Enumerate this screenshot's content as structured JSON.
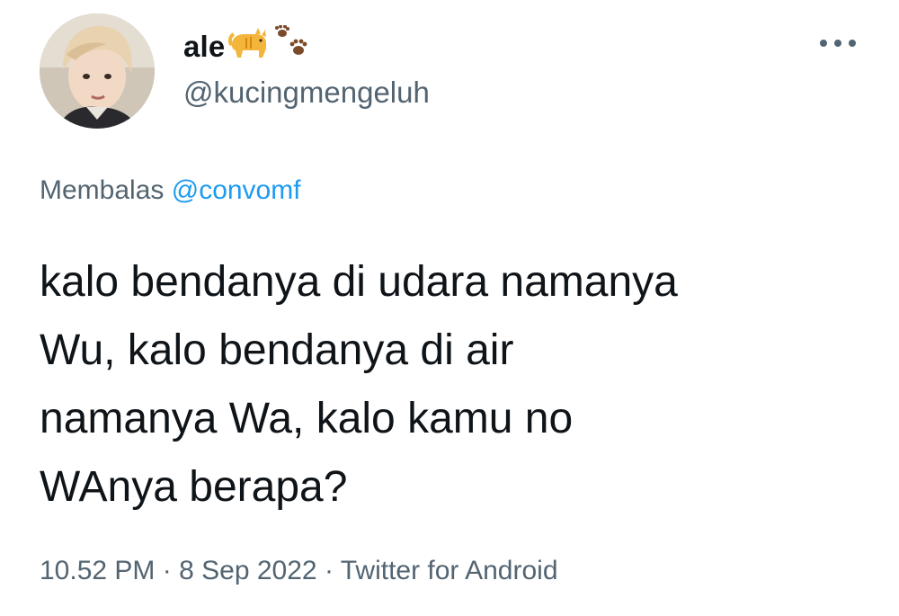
{
  "author": {
    "display_name": "ale",
    "handle": "@kucingmengeluh",
    "avatar": "avatar",
    "emojis": [
      "cat-emoji",
      "paw-prints-emoji"
    ]
  },
  "reply": {
    "prefix": "Membalas",
    "to": "@convomf"
  },
  "tweet": {
    "lines": [
      "kalo bendanya di udara namanya",
      "Wu, kalo bendanya di air",
      "namanya Wa, kalo kamu no",
      "WAnya berapa?"
    ]
  },
  "meta": {
    "time": "10.52 PM",
    "sep1": "·",
    "date": "8 Sep 2022",
    "sep2": "·",
    "source": "Twitter for Android"
  },
  "colors": {
    "text": "#0f1419",
    "secondary": "#536471",
    "accent": "#1d9bf0"
  },
  "icons": {
    "more": "more-horizontal-icon"
  }
}
